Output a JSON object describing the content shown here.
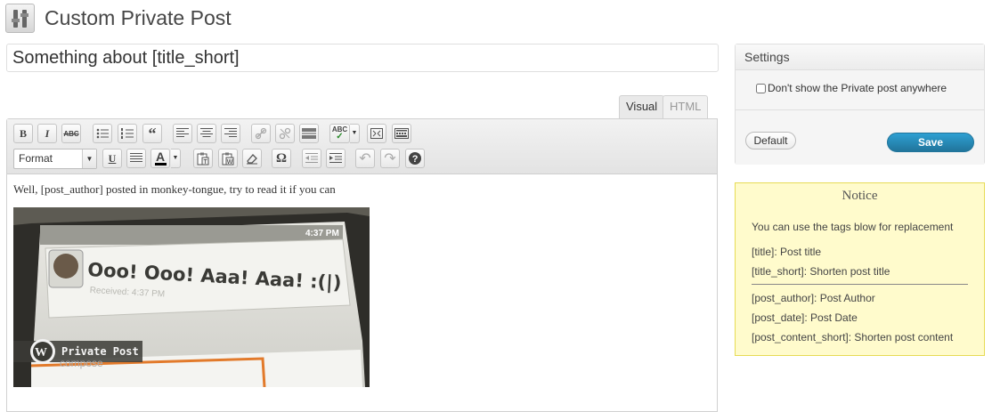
{
  "page": {
    "title": "Custom Private Post"
  },
  "post": {
    "title_value": "Something about [title_short]"
  },
  "editor": {
    "tabs": {
      "visual": "Visual",
      "html": "HTML"
    },
    "format_select": "Format",
    "content_text": "Well, [post_author] posted in monkey-tongue, try to read it if you can",
    "image": {
      "message": "Ooo! Ooo! Aaa! Aaa! :(|)",
      "received": "Received: 4:37 PM",
      "status_time": "4:37 PM",
      "compose": "compose",
      "brand_label": "Private Post"
    },
    "toolbar_icons": [
      "bold-icon",
      "italic-icon",
      "strikethrough-icon",
      "bullet-list-icon",
      "numbered-list-icon",
      "blockquote-icon",
      "align-left-icon",
      "align-center-icon",
      "align-right-icon",
      "link-icon",
      "unlink-icon",
      "more-tag-icon",
      "spellcheck-icon",
      "fullscreen-icon",
      "kitchen-sink-icon",
      "underline-icon",
      "justify-icon",
      "text-color-icon",
      "paste-text-icon",
      "paste-word-icon",
      "remove-format-icon",
      "special-char-icon",
      "outdent-icon",
      "indent-icon",
      "undo-icon",
      "redo-icon",
      "help-icon"
    ]
  },
  "settings": {
    "title": "Settings",
    "checkbox_label": "Don't show the Private post anywhere",
    "checkbox_checked": false,
    "default_button": "Default",
    "save_button": "Save",
    "accent_color": "#21759b"
  },
  "notice": {
    "title": "Notice",
    "intro": "You can use the tags blow for replacement",
    "tags": [
      "[title]: Post title",
      "[title_short]: Shorten post title",
      "[post_author]: Post Author",
      "[post_date]: Post Date",
      "[post_content_short]: Shorten post content"
    ],
    "background_color": "#fffbcc"
  }
}
